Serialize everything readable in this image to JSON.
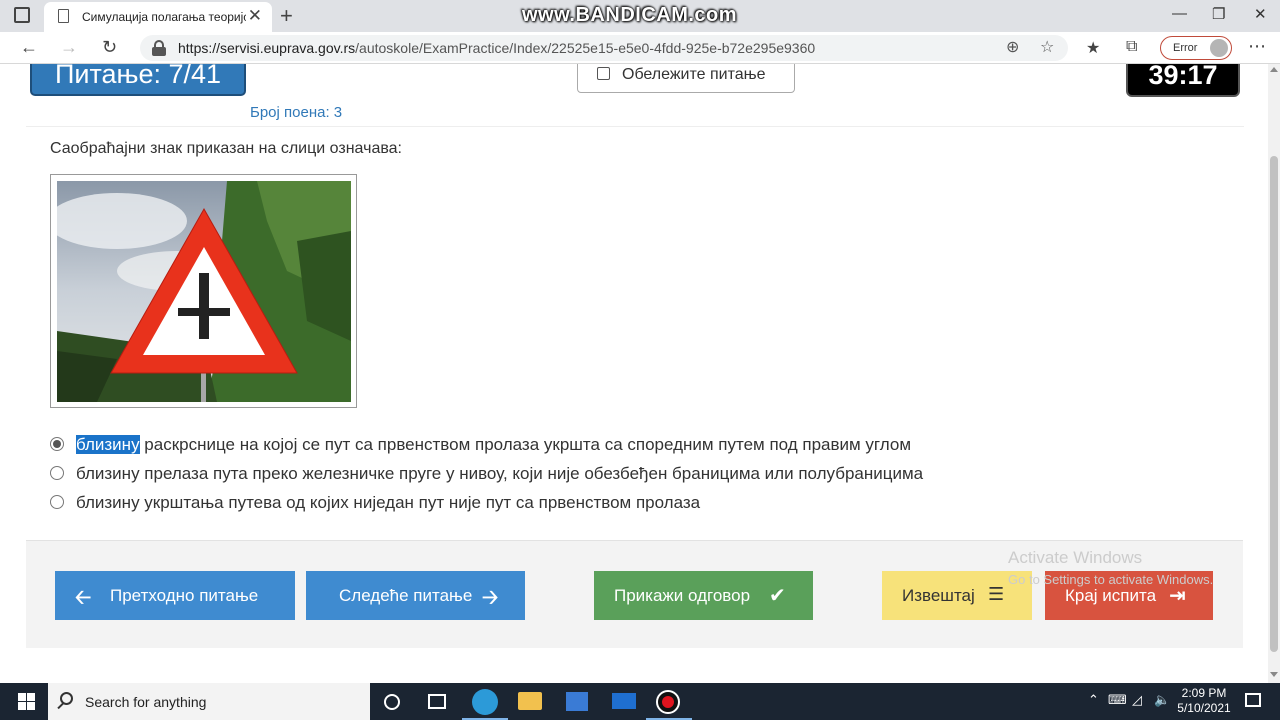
{
  "browser": {
    "tab_title": "Симулација полагања теоријск",
    "watermark": "www.BANDICAM.com",
    "url_domain": "https://servisi.euprava.gov.rs",
    "url_path": "/autoskole/ExamPractice/Index/22525e15-e5e0-4fdd-925e-b72e295e9360",
    "profile_status": "Error"
  },
  "exam": {
    "question_counter": "Питање: 7/41",
    "points": "Број поена: 3",
    "mark_label": "Обележите питање",
    "timer": "39:17",
    "question": "Саобраћајни знак приказан на слици означава:"
  },
  "answers": [
    {
      "highlight": "близину",
      "rest": " раскрснице на којој се пут са првенством пролаза укршта са споредним путем под правим углом",
      "selected": true
    },
    {
      "highlight": "",
      "rest": "близину прелаза пута преко железничке пруге у нивоу, који није обезбеђен браницима или полубраницима",
      "selected": false
    },
    {
      "highlight": "",
      "rest": "близину укрштања путева од којих ниједан пут није пут са првенством пролаза",
      "selected": false
    }
  ],
  "buttons": {
    "prev": "Претходно питање",
    "next": "Следеће питање",
    "show": "Прикажи одговор",
    "report": "Извештај",
    "end": "Крај испита"
  },
  "watermark_activate": {
    "line1": "Activate Windows",
    "line2": "Go to Settings to activate Windows."
  },
  "taskbar": {
    "search_placeholder": "Search for anything",
    "time": "2:09 PM",
    "date": "5/10/2021"
  },
  "colors": {
    "counter_blue": "#3179b8",
    "nav_button_blue": "#3f8bd0",
    "show_button_green": "#5aa05a",
    "report_button_yellow": "#f7e27a",
    "end_button_red": "#d8533f",
    "sign_red": "#e8321c"
  },
  "icons": {
    "prev": "arrow-left-icon",
    "next": "arrow-right-icon",
    "show": "checkmark-icon",
    "report": "list-icon",
    "end": "sign-out-icon"
  }
}
